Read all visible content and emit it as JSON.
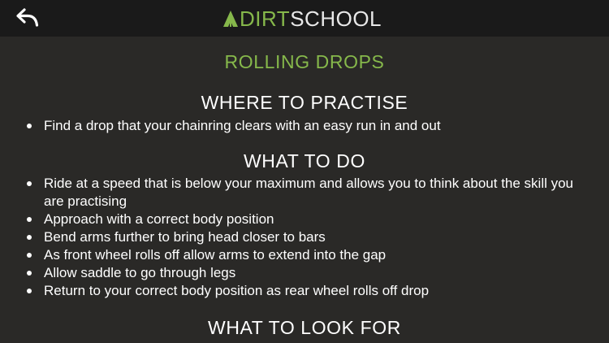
{
  "header": {
    "back_icon": "back-arrow-icon",
    "logo_icon": "tree-icon",
    "logo_part1": "DIRT",
    "logo_part2": "SCHOOL",
    "brand_color": "#86b84b"
  },
  "main": {
    "title": "ROLLING DROPS",
    "sections": [
      {
        "heading": "WHERE TO PRACTISE",
        "items": [
          "Find a drop that your chainring clears with an easy run in and out"
        ]
      },
      {
        "heading": "WHAT TO DO",
        "items": [
          "Ride at a speed that is below your maximum and allows you to think about the skill you are practising",
          "Approach with a correct body position",
          "Bend arms further to bring head closer to bars",
          "As front wheel rolls off allow arms to extend into the gap",
          "Allow saddle to go through legs",
          "Return to your correct body position as rear wheel rolls off drop"
        ]
      },
      {
        "heading": "WHAT TO LOOK FOR",
        "items": []
      }
    ]
  }
}
